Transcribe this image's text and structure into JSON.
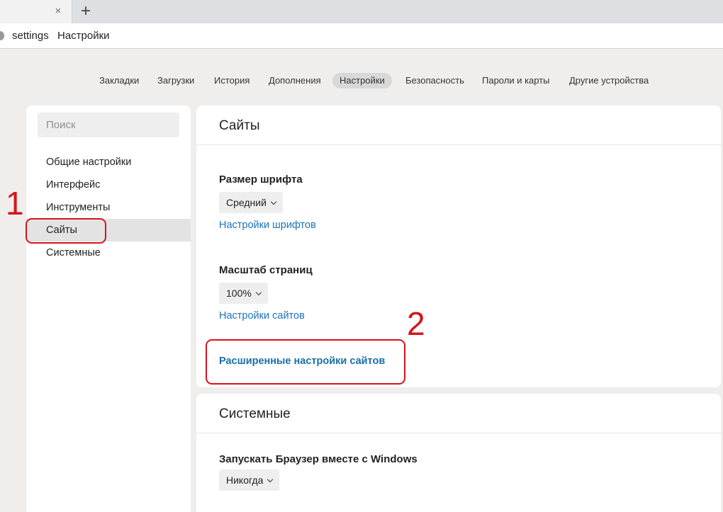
{
  "browser": {
    "tab_close": "×",
    "new_tab": "+",
    "address_scheme": "settings",
    "address_title": "Настройки"
  },
  "topnav": {
    "items": [
      {
        "label": "Закладки"
      },
      {
        "label": "Загрузки"
      },
      {
        "label": "История"
      },
      {
        "label": "Дополнения"
      },
      {
        "label": "Настройки",
        "active": true
      },
      {
        "label": "Безопасность"
      },
      {
        "label": "Пароли и карты"
      },
      {
        "label": "Другие устройства"
      }
    ]
  },
  "sidebar": {
    "search_placeholder": "Поиск",
    "items": [
      {
        "label": "Общие настройки"
      },
      {
        "label": "Интерфейс"
      },
      {
        "label": "Инструменты"
      },
      {
        "label": "Сайты",
        "active": true
      },
      {
        "label": "Системные"
      }
    ]
  },
  "sites": {
    "title": "Сайты",
    "font_size_label": "Размер шрифта",
    "font_size_value": "Средний",
    "font_settings_link": "Настройки шрифтов",
    "zoom_label": "Масштаб страниц",
    "zoom_value": "100%",
    "site_settings_link": "Настройки сайтов",
    "advanced_link": "Расширенные настройки сайтов"
  },
  "system": {
    "title": "Системные",
    "autostart_label": "Запускать Браузер вместе с Windows",
    "autostart_value": "Никогда"
  },
  "annotations": {
    "step1": "1",
    "step2": "2",
    "color": "#d6141b"
  },
  "colors": {
    "page_bg": "#efeeec",
    "link": "#1a73ba",
    "active_item_bg": "#e3e3e3"
  }
}
